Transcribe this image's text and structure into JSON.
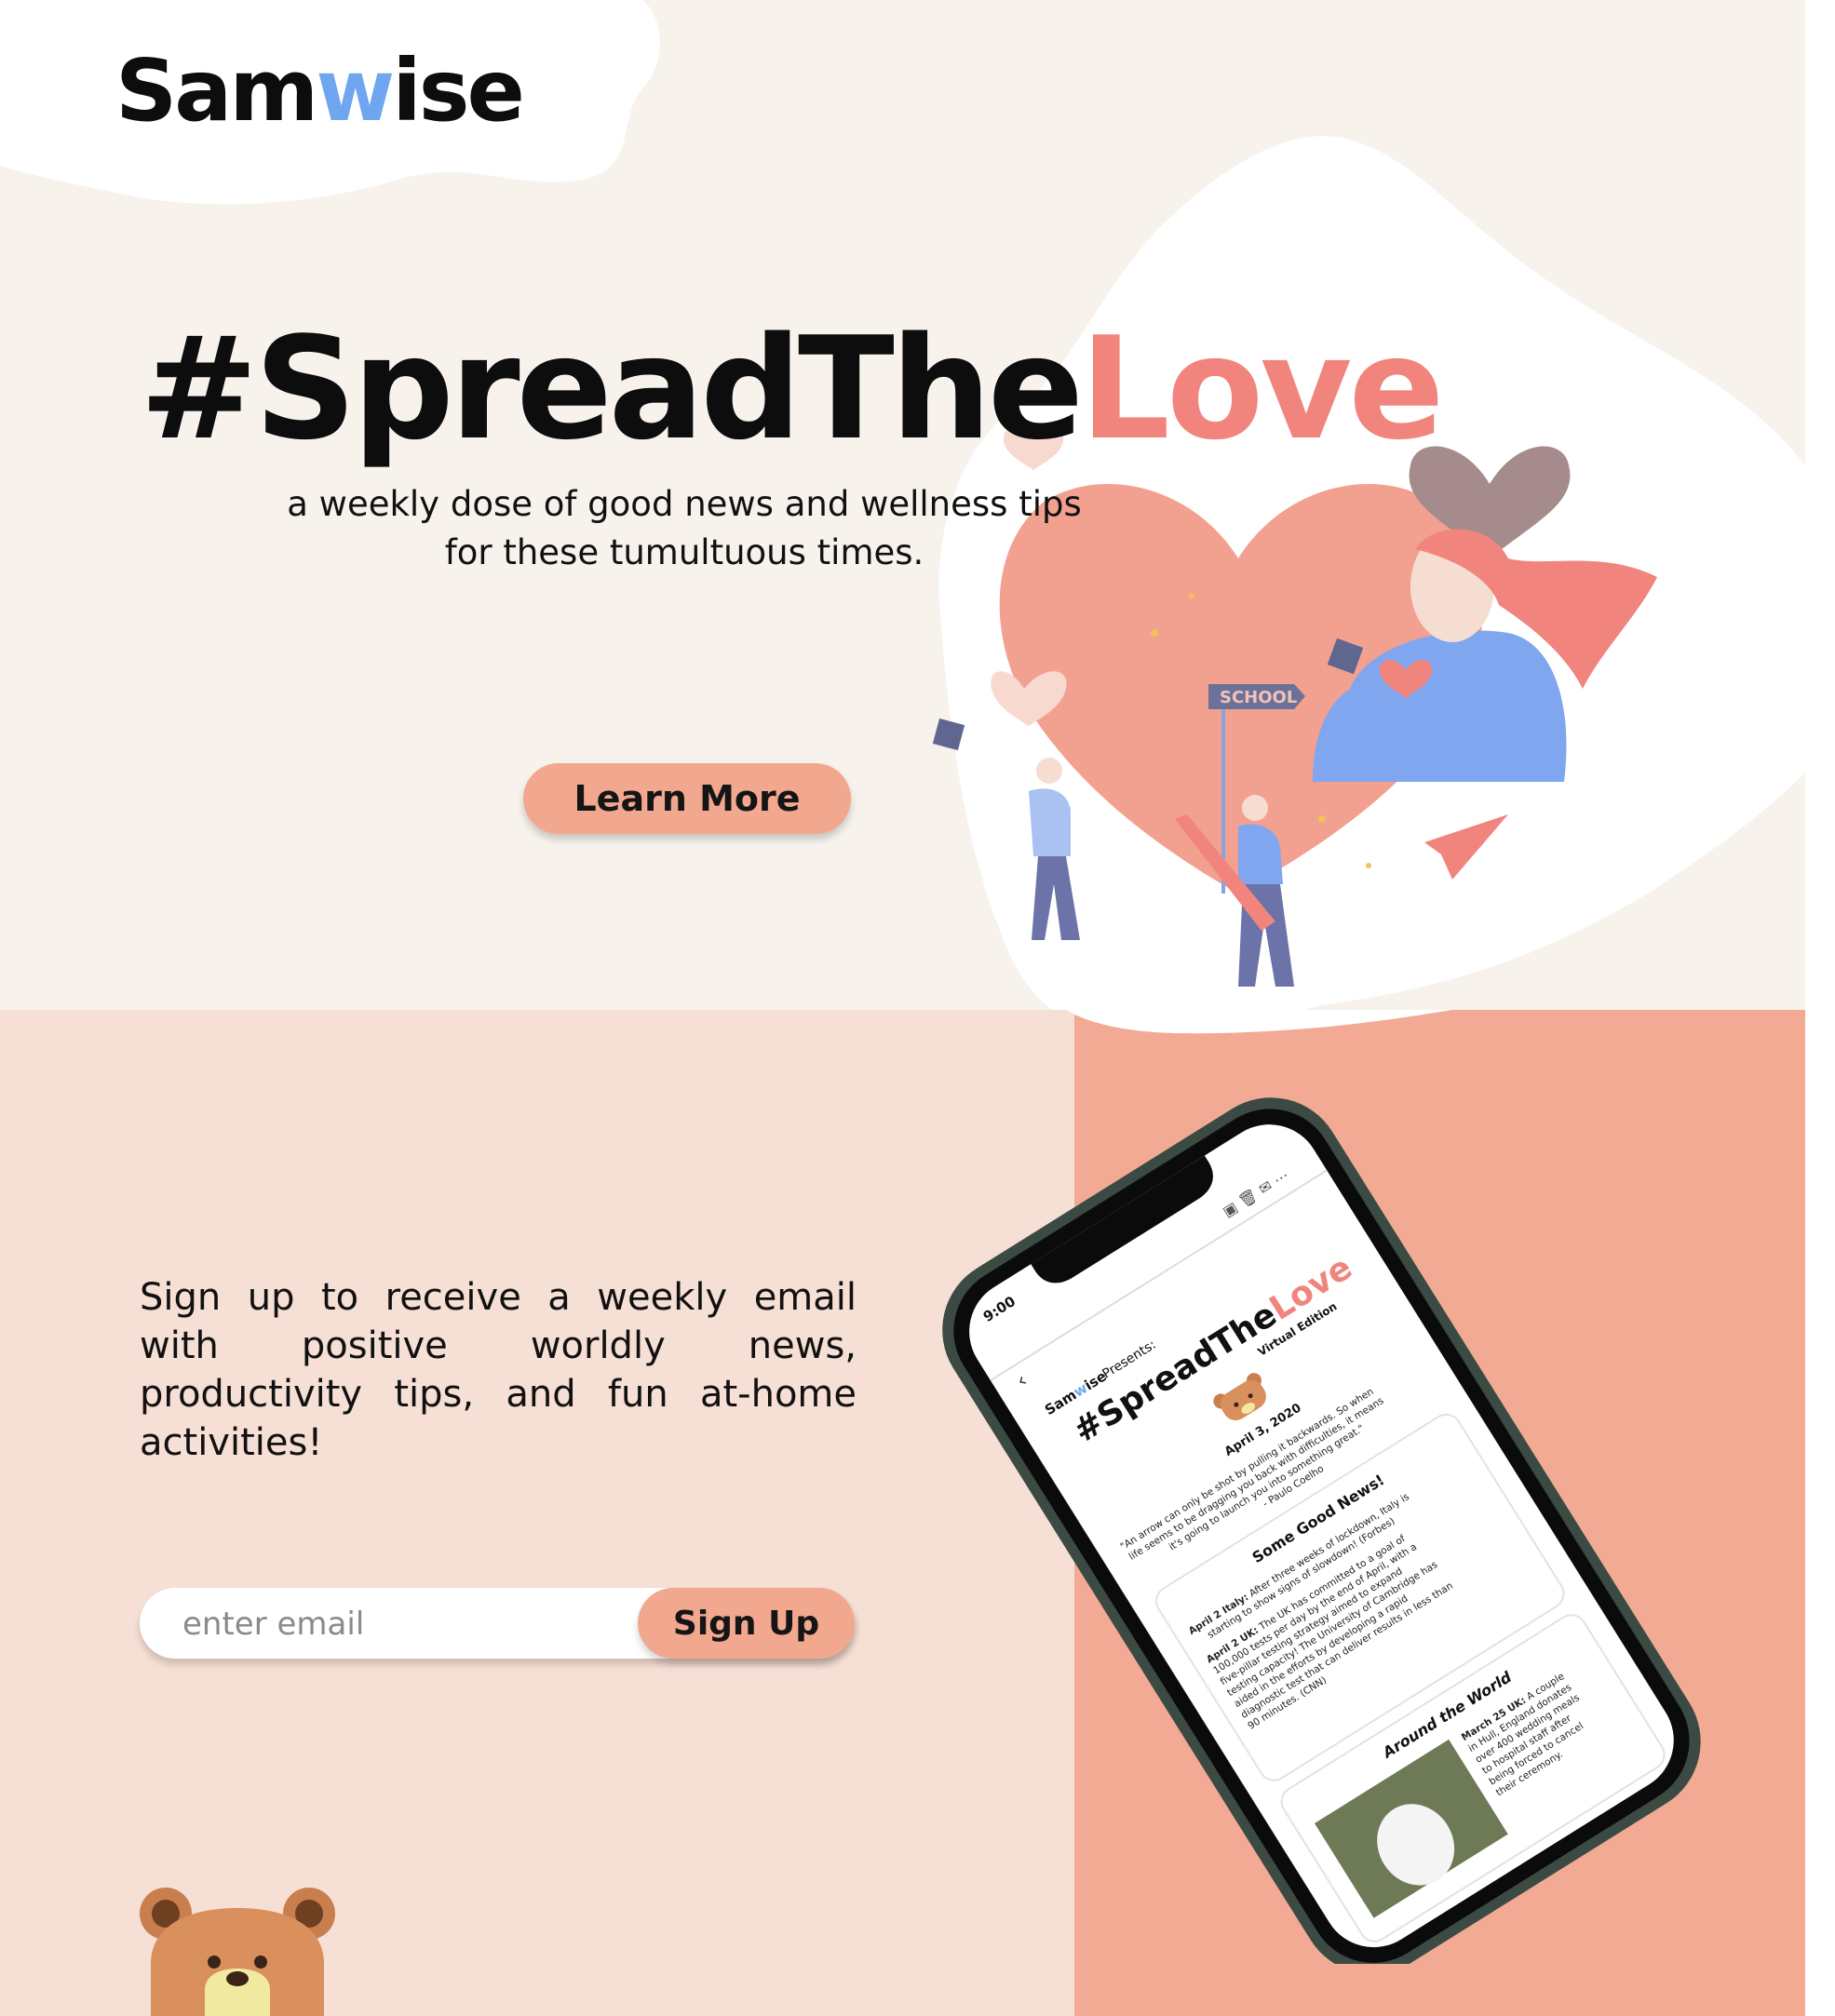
{
  "brand": {
    "prefix": "Sam",
    "accent": "w",
    "suffix": "ise",
    "accent_color": "#6fa6ef"
  },
  "hero": {
    "headline_main": "#SpreadThe",
    "headline_accent": "Love",
    "tagline_line1": "a weekly dose of good news and wellness tips",
    "tagline_line2": "for these tumultuous times.",
    "learn_more_label": "Learn More",
    "illustration_sign": "SCHOOL"
  },
  "signup": {
    "text": "Sign up to receive a weekly email with positive worldly news, productivity tips, and fun at-home activities!",
    "email_placeholder": "enter email",
    "button_label": "Sign Up"
  },
  "phone_newsletter": {
    "time": "9:00",
    "presents": "Presents:",
    "brand_prefix": "Sam",
    "brand_accent": "w",
    "brand_suffix": "ise",
    "title_main": "#SpreadThe",
    "title_accent": "Love",
    "edition": "Virtual Edition",
    "date": "April 3, 2020",
    "quote_line1": "\"An arrow can only be shot by pulling it backwards. So when",
    "quote_line2": "life seems to be dragging you back with difficulties, it means",
    "quote_line3": "it's going to launch you into something great.\"",
    "quote_author": "- Paulo Coelho",
    "section1_title": "Some Good News!",
    "item1_label": "April 2 Italy:",
    "item1_line1": "After three weeks of lockdown, Italy is",
    "item1_line2": "starting to show signs of slowdown! (Forbes)",
    "item2_label": "April 2 UK:",
    "item2_line1": "The UK has committed to a goal of",
    "item2_line2": "100,000 tests per day by the end of April, with a",
    "item2_line3": "five-pillar testing strategy aimed to expand",
    "item2_line4": "testing capacity! The University of Cambridge has",
    "item2_line5": "aided in the efforts by developing a rapid",
    "item2_line6": "diagnostic test that can deliver results in less than",
    "item2_line7": "90 minutes. (CNN)",
    "section2_title": "Around the World",
    "item3_label": "March 25 UK:",
    "item3_line1": "A couple",
    "item3_line2": "in Hull, England donates",
    "item3_line3": "over 400 wedding meals",
    "item3_line4": "to hospital staff after",
    "item3_line5": "being forced to cancel",
    "item3_line6": "their ceremony."
  },
  "colors": {
    "hero_bg": "#f7f2ec",
    "signup_bg": "#f6dfd4",
    "phone_panel_bg": "#f2aa95",
    "button": "#f2a78f",
    "accent_love": "#f2847e",
    "accent_blue": "#6fa6ef"
  }
}
